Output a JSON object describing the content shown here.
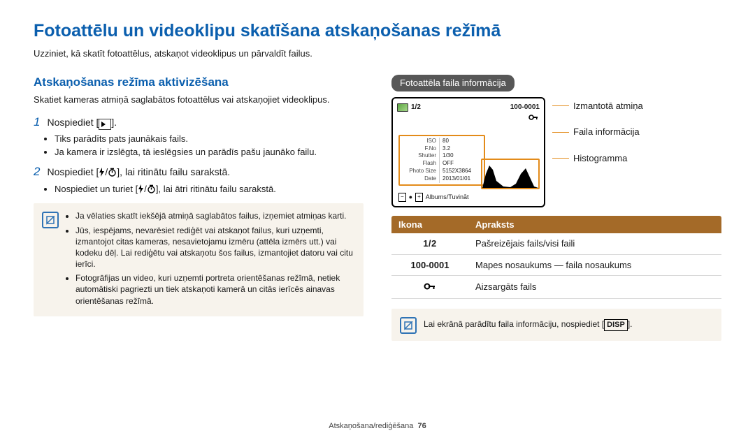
{
  "title": "Fotoattēlu un videoklipu skatīšana atskaņošanas režīmā",
  "intro": "Uzziniet, kā skatīt fotoattēlus, atskaņot videoklipus un pārvaldīt failus.",
  "left": {
    "h2": "Atskaņošanas režīma aktivizēšana",
    "sub": "Skatiet kameras atmiņā saglabātos fotoattēlus vai atskaņojiet videoklipus.",
    "step1_prefix": "Nospiediet [",
    "step1_suffix": "].",
    "step1_b1": "Tiks parādīts pats jaunākais fails.",
    "step1_b2": "Ja kamera ir izslēgta, tā ieslēgsies un parādīs pašu jaunāko failu.",
    "step2_prefix": "Nospiediet [",
    "step2_mid": "/",
    "step2_suffix": "], lai ritinātu failu sarakstā.",
    "step2_b1_a": "Nospiediet un turiet [",
    "step2_b1_b": "/",
    "step2_b1_c": "], lai ātri ritinātu failu sarakstā.",
    "note1": "Ja vēlaties skatīt iekšējā atmiņā saglabātos failus, izņemiet atmiņas karti.",
    "note2": "Jūs, iespējams, nevarēsiet rediģēt vai atskaņot failus, kuri uzņemti, izmantojot citas kameras, nesavietojamu izmēru (attēla izmērs utt.) vai kodeku dēļ. Lai rediģētu vai atskaņotu šos failus, izmantojiet datoru vai citu ierīci.",
    "note3": "Fotogrāfijas un video, kuri uzņemti portreta orientēšanas režīmā, netiek automātiski pagriezti un tiek atskaņoti kamerā un citās ierīcēs ainavas orientēšanas režīmā."
  },
  "right": {
    "pill": "Fotoattēla faila informācija",
    "screen": {
      "counter": "1/2",
      "filecode": "100-0001",
      "iso_l": "ISO",
      "iso_v": "80",
      "fno_l": "F.No",
      "fno_v": "3.2",
      "sh_l": "Shutter",
      "sh_v": "1/30",
      "fl_l": "Flash",
      "fl_v": "OFF",
      "ps_l": "Photo Size",
      "ps_v": "5152X3864",
      "dt_l": "Date",
      "dt_v": "2013/01/01",
      "bottom": "Albums/Tuvināt"
    },
    "callout1": "Izmantotā atmiņa",
    "callout2": "Faila informācija",
    "callout3": "Histogramma",
    "legend_h1": "Ikona",
    "legend_h2": "Apraksts",
    "legend": [
      {
        "icon": "1/2",
        "desc": "Pašreizējais fails/visi faili"
      },
      {
        "icon": "100-0001",
        "desc": "Mapes nosaukums — faila nosaukums"
      },
      {
        "icon": "key",
        "desc": "Aizsargāts fails"
      }
    ],
    "tip_a": "Lai ekrānā parādītu faila informāciju, nospiediet [",
    "tip_b": "DISP",
    "tip_c": "]."
  },
  "footer": {
    "section": "Atskaņošana/rediģēšana",
    "page": "76"
  }
}
